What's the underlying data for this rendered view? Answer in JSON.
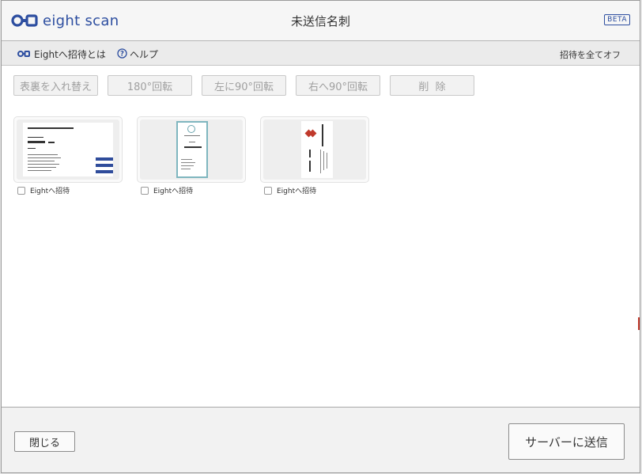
{
  "app": {
    "logo_text": "eight scan",
    "window_title": "未送信名刺",
    "badge": "BETA",
    "brand_color": "#2d4ea0"
  },
  "toolbar": {
    "invite_info_label": "Eightへ招待とは",
    "invite_info_icon": "eight-logo-icon",
    "help_label": "ヘルプ",
    "help_icon": "question-circle-icon",
    "all_off_label": "招待を全てオフ"
  },
  "actions": [
    {
      "label": "表裏を入れ替え"
    },
    {
      "label": "180°回転"
    },
    {
      "label": "左に90°回転"
    },
    {
      "label": "右へ90°回転"
    },
    {
      "label": "削  除"
    }
  ],
  "cards": [
    {
      "invite_label": "Eightへ招待",
      "checked": false,
      "orientation": "horizontal"
    },
    {
      "invite_label": "Eightへ招待",
      "checked": false,
      "orientation": "vertical"
    },
    {
      "invite_label": "Eightへ招待",
      "checked": false,
      "orientation": "vertical"
    }
  ],
  "footer": {
    "close_label": "閉じる",
    "send_label": "サーバーに送信"
  }
}
